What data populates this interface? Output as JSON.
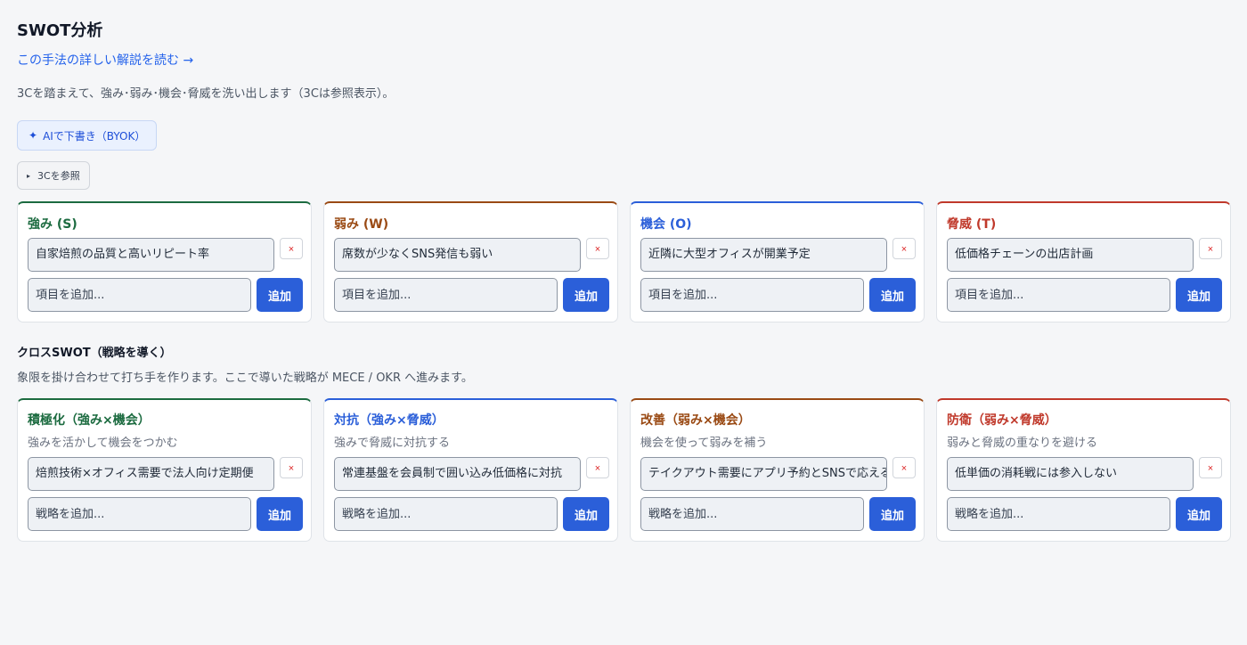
{
  "header": {
    "title": "SWOT分析",
    "guide_link": "この手法の詳しい解説を読む →",
    "description": "3Cを踏まえて、強み･弱み･機会･脅威を洗い出します（3Cは参照表示）。",
    "ai_button": "AIで下書き（BYOK）",
    "ref_toggle": "3Cを参照"
  },
  "swot": {
    "placeholder": "項目を追加...",
    "add_label": "追加",
    "delete_label": "×",
    "cards": [
      {
        "title": "強み (S)",
        "items": [
          "自家焙煎の品質と高いリピート率"
        ]
      },
      {
        "title": "弱み (W)",
        "items": [
          "席数が少なくSNS発信も弱い"
        ]
      },
      {
        "title": "機会 (O)",
        "items": [
          "近隣に大型オフィスが開業予定"
        ]
      },
      {
        "title": "脅威 (T)",
        "items": [
          "低価格チェーンの出店計画"
        ]
      }
    ]
  },
  "cross": {
    "title": "クロスSWOT（戦略を導く）",
    "description": "象限を掛け合わせて打ち手を作ります。ここで導いた戦略が MECE / OKR へ進みます。",
    "placeholder": "戦略を追加...",
    "add_label": "追加",
    "delete_label": "×",
    "cards": [
      {
        "title": "積極化（強み×機会）",
        "subtitle": "強みを活かして機会をつかむ",
        "items": [
          "焙煎技術×オフィス需要で法人向け定期便"
        ]
      },
      {
        "title": "対抗（強み×脅威）",
        "subtitle": "強みで脅威に対抗する",
        "items": [
          "常連基盤を会員制で囲い込み低価格に対抗"
        ]
      },
      {
        "title": "改善（弱み×機会）",
        "subtitle": "機会を使って弱みを補う",
        "items": [
          "テイクアウト需要にアプリ予約とSNSで応える"
        ]
      },
      {
        "title": "防衛（弱み×脅威）",
        "subtitle": "弱みと脅威の重なりを避ける",
        "items": [
          "低単価の消耗戦には参入しない"
        ]
      }
    ]
  },
  "colors": {
    "accent": "#2b5fd9",
    "strength": "#1c6b40",
    "weakness": "#9a4a14",
    "opportunity": "#2b5fd9",
    "threat": "#c0392b"
  }
}
